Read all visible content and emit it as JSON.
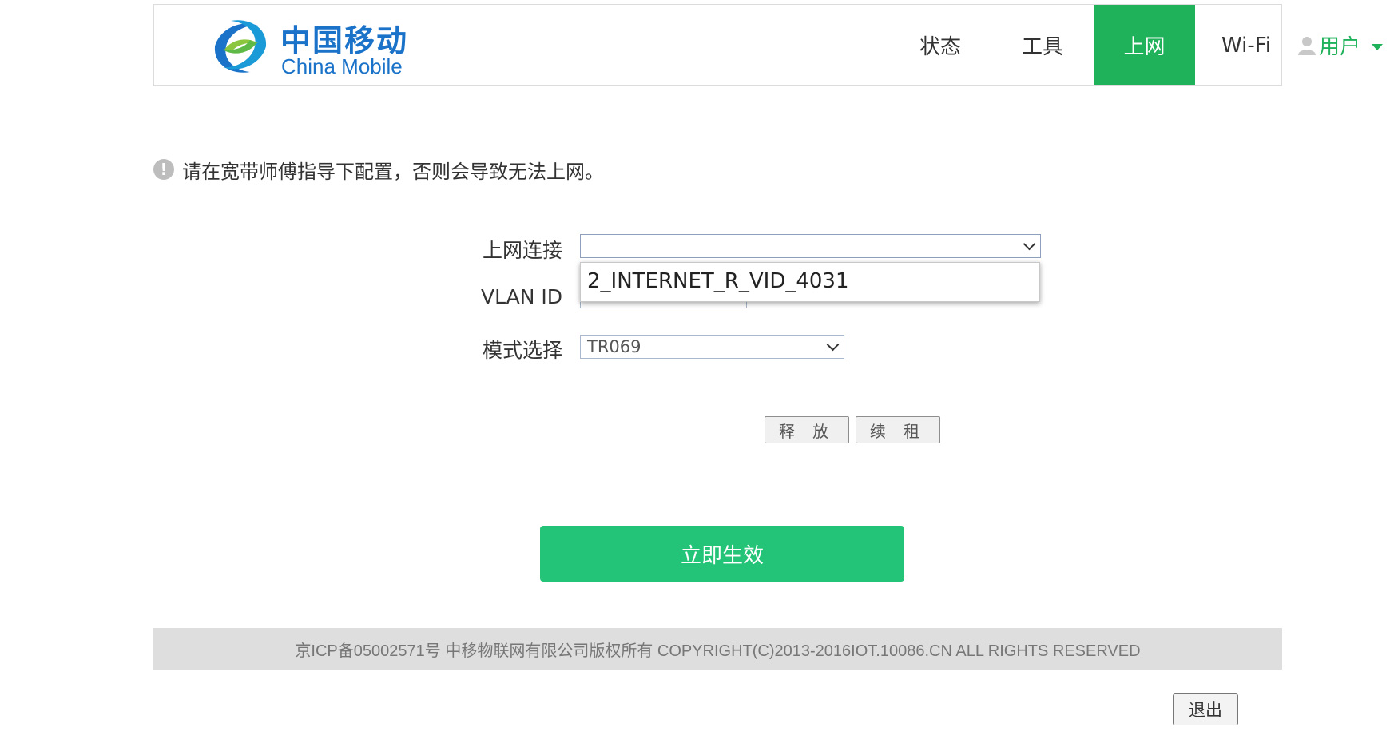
{
  "header": {
    "logo_cn": "中国移动",
    "logo_en": "China Mobile",
    "nav": {
      "status": "状态",
      "tools": "工具",
      "internet": "上网",
      "wifi": "Wi-Fi",
      "user": "用户"
    },
    "active_tab": "internet",
    "icons": {
      "logo": "china-mobile-logo",
      "user": "user-icon",
      "user_menu": "caret-down-icon"
    }
  },
  "notice": {
    "icon": "exclamation-circle-icon",
    "text": "请在宽带师傅指导下配置，否则会导致无法上网。"
  },
  "form": {
    "connection_label": "上网连接",
    "connection_value": "",
    "connection_options": [
      "2_INTERNET_R_VID_4031"
    ],
    "vlan_label": "VLAN ID",
    "vlan_value": "",
    "mode_label": "模式选择",
    "mode_value": "TR069"
  },
  "buttons": {
    "release": "释 放",
    "renew": "续 租",
    "apply": "立即生效",
    "logout": "退出"
  },
  "footer": {
    "text": "京ICP备05002571号 中移物联网有限公司版权所有 COPYRIGHT(C)2013-2016IOT.10086.CN ALL RIGHTS RESERVED"
  },
  "colors": {
    "brand_blue": "#1a73c9",
    "active_green": "#1fb25a",
    "apply_green": "#23c477",
    "footer_bg": "#dedede"
  }
}
